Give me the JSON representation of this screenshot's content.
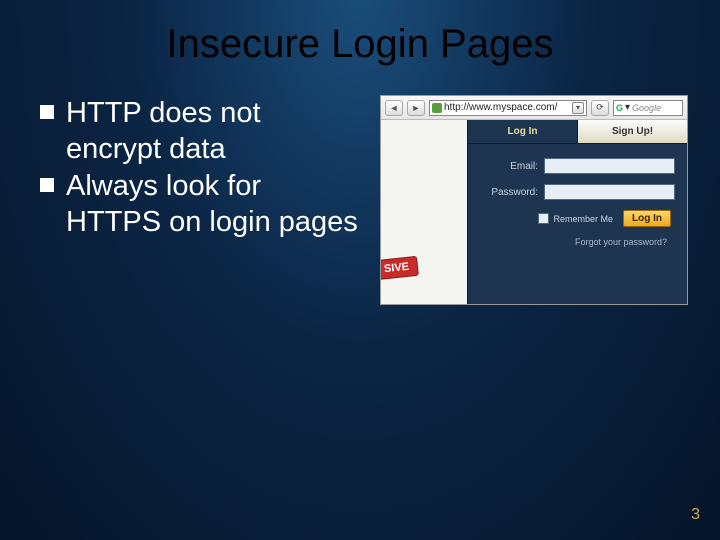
{
  "title": "Insecure Login Pages",
  "bullets": [
    "HTTP does not encrypt data",
    "Always look for HTTPS on login pages"
  ],
  "browser": {
    "url": "http://www.myspace.com/",
    "search_placeholder": "Google",
    "search_prefix": "G"
  },
  "stamp": "SIVE",
  "login_panel": {
    "tab_login": "Log In",
    "tab_signup": "Sign Up!",
    "email_label": "Email:",
    "password_label": "Password:",
    "remember_label": "Remember Me",
    "login_button": "Log In",
    "forgot": "Forgot your password?"
  },
  "page_number": "3"
}
